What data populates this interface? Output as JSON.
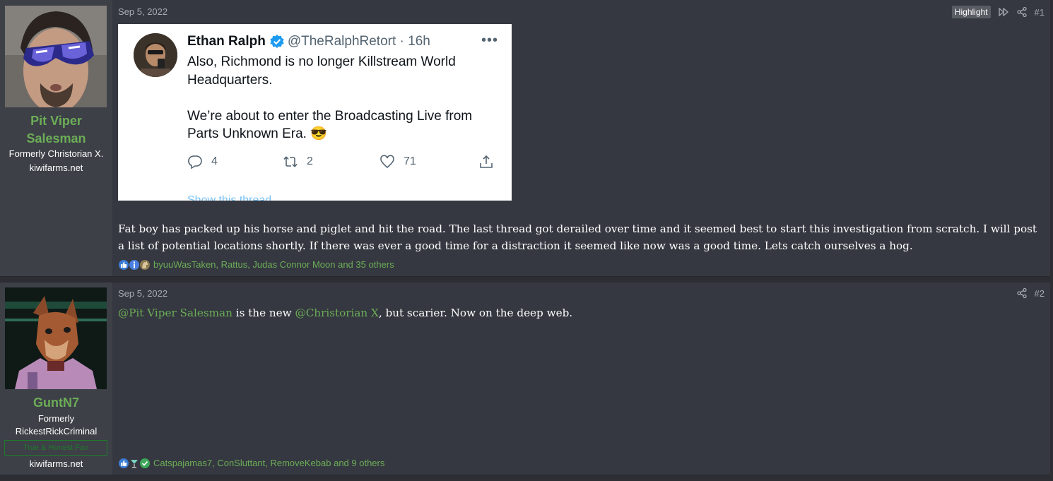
{
  "posts": [
    {
      "author": "Pit Viper Salesman",
      "usertitle": "Formerly Christorian X.",
      "site": "kiwifarms.net",
      "date": "Sep 5, 2022",
      "highlight_label": "Highlight",
      "post_number": "#1",
      "tweet": {
        "name": "Ethan Ralph",
        "handle": "@TheRalphRetort · 16h",
        "more": "•••",
        "text_line1": "Also, Richmond is no longer Killstream World Headquarters.",
        "text_line2": "We’re about to enter the Broadcasting Live from Parts Unknown Era. 😎",
        "replies": "4",
        "retweets": "2",
        "likes": "71",
        "show_thread": "Show this thread"
      },
      "body": "Fat boy has packed up his horse and piglet and hit the road. The last thread got derailed over time and it seemed best to start this investigation from scratch. I will post a list of potential locations shortly. If there was ever a good time for a distraction it seemed like now was a good time. Lets catch ourselves a hog.",
      "reactions": "byuuWasTaken, Rattus, Judas Connor Moon and 35 others",
      "reaction_icons": [
        "thumbs-up-icon",
        "informative-icon",
        "horse-icon"
      ]
    },
    {
      "author": "GuntN7",
      "usertitle_line1": "Formerly",
      "usertitle_line2": "RickestRickCriminal",
      "badge": "True & Honest Fan",
      "site": "kiwifarms.net",
      "date": "Sep 5, 2022",
      "post_number": "#2",
      "mention1": "@Pit Viper Salesman",
      "text1": " is the new ",
      "mention2": "@Christorian X",
      "text2": ", but scarier. Now on the deep web.",
      "reactions": "Catspajamas7, ConSluttant, RemoveKebab and 9 others",
      "reaction_icons": [
        "thumbs-up-icon",
        "cocktail-icon",
        "checkmark-icon"
      ]
    }
  ],
  "colors": {
    "username": "#6cad57",
    "post_bg": "#353840",
    "user_cell_bg": "#3d4047"
  }
}
